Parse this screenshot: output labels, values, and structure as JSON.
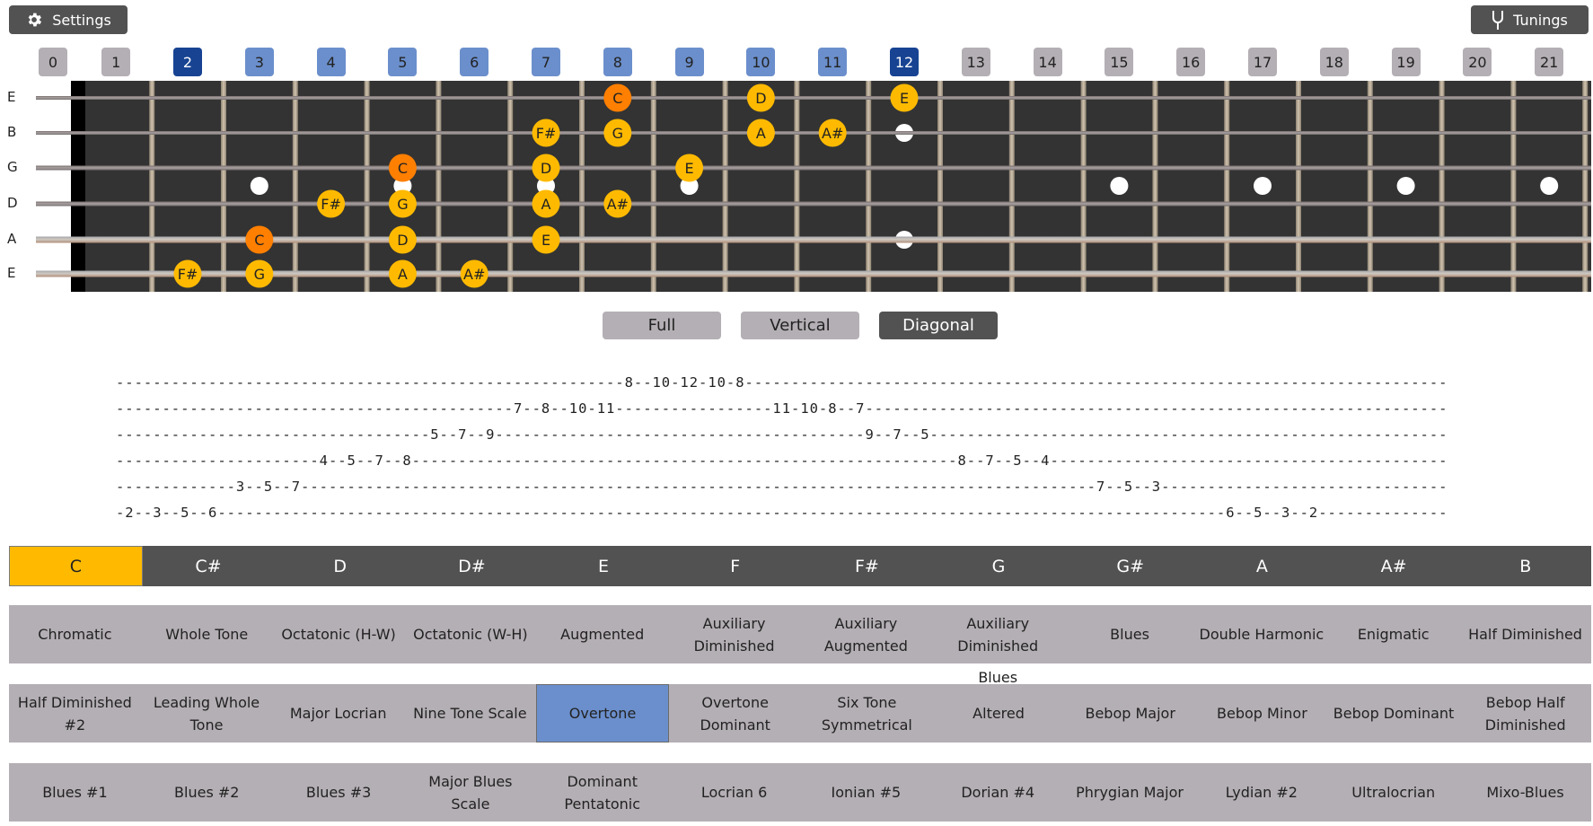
{
  "header": {
    "settings_label": "Settings",
    "settings_icon": "gear-icon",
    "tunings_label": "Tunings",
    "tunings_icon": "tuning-fork-icon"
  },
  "colors": {
    "root_note": "#ff7f00",
    "scale_note": "#ffba00",
    "fret_label_default": "#b4afb4",
    "fret_label_in_pattern": "#6b8fcc",
    "fret_label_pattern_edge": "#174392",
    "selected_scale": "#6b8fcc",
    "selected_key": "#ffba00",
    "dark_button": "#525252"
  },
  "fretboard": {
    "fret_labels": [
      {
        "n": "0",
        "state": "grey"
      },
      {
        "n": "1",
        "state": "grey"
      },
      {
        "n": "2",
        "state": "dark"
      },
      {
        "n": "3",
        "state": "light"
      },
      {
        "n": "4",
        "state": "light"
      },
      {
        "n": "5",
        "state": "light"
      },
      {
        "n": "6",
        "state": "light"
      },
      {
        "n": "7",
        "state": "light"
      },
      {
        "n": "8",
        "state": "light"
      },
      {
        "n": "9",
        "state": "light"
      },
      {
        "n": "10",
        "state": "light"
      },
      {
        "n": "11",
        "state": "light"
      },
      {
        "n": "12",
        "state": "dark"
      },
      {
        "n": "13",
        "state": "grey"
      },
      {
        "n": "14",
        "state": "grey"
      },
      {
        "n": "15",
        "state": "grey"
      },
      {
        "n": "16",
        "state": "grey"
      },
      {
        "n": "17",
        "state": "grey"
      },
      {
        "n": "18",
        "state": "grey"
      },
      {
        "n": "19",
        "state": "grey"
      },
      {
        "n": "20",
        "state": "grey"
      },
      {
        "n": "21",
        "state": "grey"
      }
    ],
    "strings": [
      "E",
      "B",
      "G",
      "D",
      "A",
      "E"
    ],
    "single_dot_frets": [
      3,
      5,
      7,
      9,
      15,
      17,
      19,
      21
    ],
    "double_dot_frets": [
      12
    ],
    "notes": [
      {
        "string": 0,
        "fret": 8,
        "label": "C",
        "root": true
      },
      {
        "string": 0,
        "fret": 10,
        "label": "D",
        "root": false
      },
      {
        "string": 0,
        "fret": 12,
        "label": "E",
        "root": false
      },
      {
        "string": 1,
        "fret": 7,
        "label": "F#",
        "root": false
      },
      {
        "string": 1,
        "fret": 8,
        "label": "G",
        "root": false
      },
      {
        "string": 1,
        "fret": 10,
        "label": "A",
        "root": false
      },
      {
        "string": 1,
        "fret": 11,
        "label": "A#",
        "root": false
      },
      {
        "string": 2,
        "fret": 5,
        "label": "C",
        "root": true
      },
      {
        "string": 2,
        "fret": 7,
        "label": "D",
        "root": false
      },
      {
        "string": 2,
        "fret": 9,
        "label": "E",
        "root": false
      },
      {
        "string": 3,
        "fret": 4,
        "label": "F#",
        "root": false
      },
      {
        "string": 3,
        "fret": 5,
        "label": "G",
        "root": false
      },
      {
        "string": 3,
        "fret": 7,
        "label": "A",
        "root": false
      },
      {
        "string": 3,
        "fret": 8,
        "label": "A#",
        "root": false
      },
      {
        "string": 4,
        "fret": 3,
        "label": "C",
        "root": true
      },
      {
        "string": 4,
        "fret": 5,
        "label": "D",
        "root": false
      },
      {
        "string": 4,
        "fret": 7,
        "label": "E",
        "root": false
      },
      {
        "string": 5,
        "fret": 2,
        "label": "F#",
        "root": false
      },
      {
        "string": 5,
        "fret": 3,
        "label": "G",
        "root": false
      },
      {
        "string": 5,
        "fret": 5,
        "label": "A",
        "root": false
      },
      {
        "string": 5,
        "fret": 6,
        "label": "A#",
        "root": false
      }
    ]
  },
  "modes": {
    "buttons": [
      {
        "label": "Full",
        "selected": false
      },
      {
        "label": "Vertical",
        "selected": false
      },
      {
        "label": "Diagonal",
        "selected": true
      }
    ]
  },
  "tab": {
    "lines": [
      "-------------------------------------------------------8--10-12-10-8----------------------------------------------------------------------------",
      "-------------------------------------------7--8--10-11-----------------11-10-8--7---------------------------------------------------------------",
      "----------------------------------5--7--9----------------------------------------9--7--5--------------------------------------------------------",
      "----------------------4--5--7--8-----------------------------------------------------------8--7--5--4-------------------------------------------",
      "-------------3--5--7--------------------------------------------------------------------------------------7--5--3-------------------------------",
      "-2--3--5--6-------------------------------------------------------------------------------------------------------------6--5--3--2--------------"
    ]
  },
  "keys": {
    "items": [
      "C",
      "C#",
      "D",
      "D#",
      "E",
      "F",
      "F#",
      "G",
      "G#",
      "A",
      "A#",
      "B"
    ],
    "selected": "C"
  },
  "scales": {
    "rows": [
      [
        {
          "label": "Chromatic"
        },
        {
          "label": "Whole Tone"
        },
        {
          "label": "Octatonic (H-W)"
        },
        {
          "label": "Octatonic (W-H)"
        },
        {
          "label": "Augmented"
        },
        {
          "label": "Auxiliary Diminished"
        },
        {
          "label": "Auxiliary Augmented"
        },
        {
          "label": "Auxiliary Diminished",
          "overflow": "Blues"
        },
        {
          "label": "Blues"
        },
        {
          "label": "Double Harmonic"
        },
        {
          "label": "Enigmatic"
        },
        {
          "label": "Half Diminished"
        }
      ],
      [
        {
          "label": "Half Diminished #2"
        },
        {
          "label": "Leading Whole Tone"
        },
        {
          "label": "Major Locrian"
        },
        {
          "label": "Nine Tone Scale"
        },
        {
          "label": "Overtone",
          "selected": true
        },
        {
          "label": "Overtone Dominant"
        },
        {
          "label": "Six Tone Symmetrical"
        },
        {
          "label": "Altered"
        },
        {
          "label": "Bebop Major"
        },
        {
          "label": "Bebop Minor"
        },
        {
          "label": "Bebop Dominant"
        },
        {
          "label": "Bebop Half Diminished"
        }
      ],
      [
        {
          "label": "Blues #1"
        },
        {
          "label": "Blues #2"
        },
        {
          "label": "Blues #3"
        },
        {
          "label": "Major Blues Scale"
        },
        {
          "label": "Dominant Pentatonic"
        },
        {
          "label": "Locrian 6"
        },
        {
          "label": "Ionian #5"
        },
        {
          "label": "Dorian #4"
        },
        {
          "label": "Phrygian Major"
        },
        {
          "label": "Lydian #2"
        },
        {
          "label": "Ultralocrian"
        },
        {
          "label": "Mixo-Blues"
        }
      ]
    ]
  }
}
